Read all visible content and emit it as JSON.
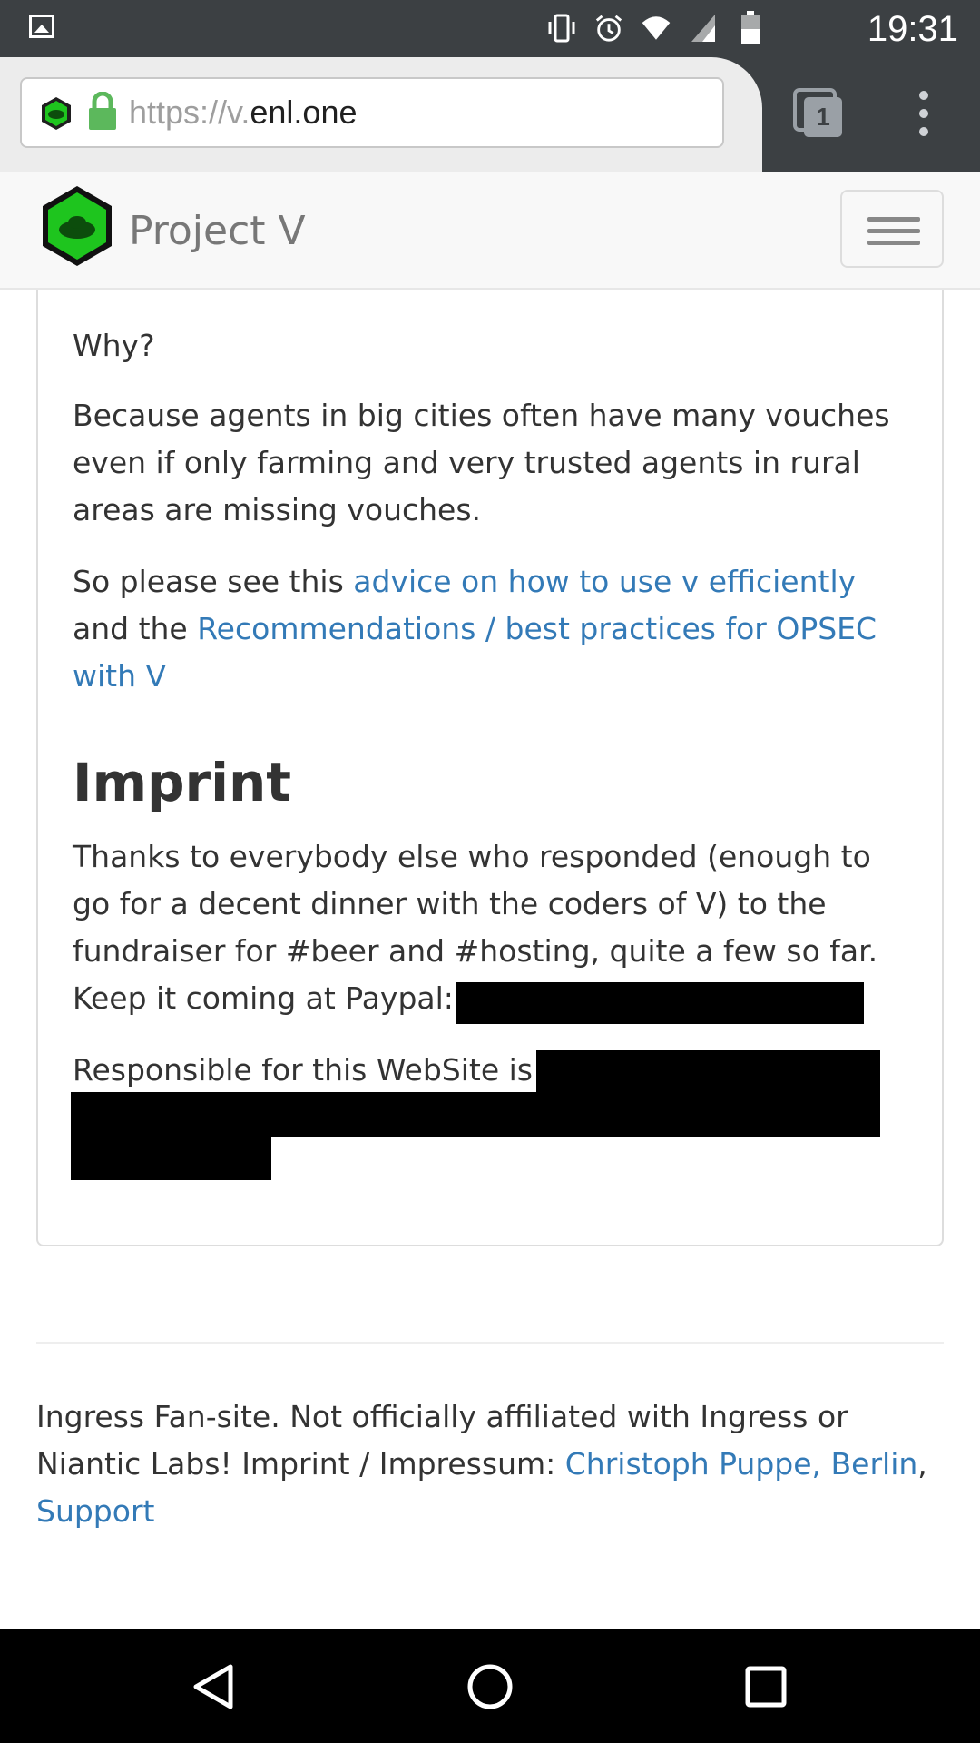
{
  "status_bar": {
    "time": "19:31",
    "icons": [
      "gallery-notification-icon",
      "vibrate-icon",
      "alarm-icon",
      "wifi-icon",
      "cell-signal-icon",
      "battery-icon"
    ]
  },
  "browser": {
    "url_scheme": "https://v.",
    "url_host": "enl.one",
    "tab_count": "1"
  },
  "navbar": {
    "brand": "Project V"
  },
  "content": {
    "why": "Why?",
    "because": "Because agents in big cities often have many vouches even if only farming and very trusted agents in rural areas are missing vouches.",
    "please_prefix": "So please see this ",
    "advice_link": "advice on how to use v efficiently",
    "and_the": " and the ",
    "opsec_link": "Recommendations / best practices for OPSEC with V",
    "imprint_heading": "Imprint",
    "thanks": "Thanks to everybody else who responded (enough to go for a decent dinner with the coders of V) to the fundraiser for #beer and #hosting, quite a few so far. Keep it coming at Paypal:",
    "responsible": "Responsible for this WebSite is"
  },
  "footer": {
    "text": "Ingress Fan-site. Not officially affiliated with Ingress or Niantic Labs! Imprint / Impressum: ",
    "author_link": "Christoph Puppe, Berlin",
    "comma": ",",
    "support_link": "Support"
  },
  "colors": {
    "link": "#337ab7",
    "text": "#333333",
    "chrome_dark": "#3c4043",
    "enl_green": "#1ec51e"
  }
}
